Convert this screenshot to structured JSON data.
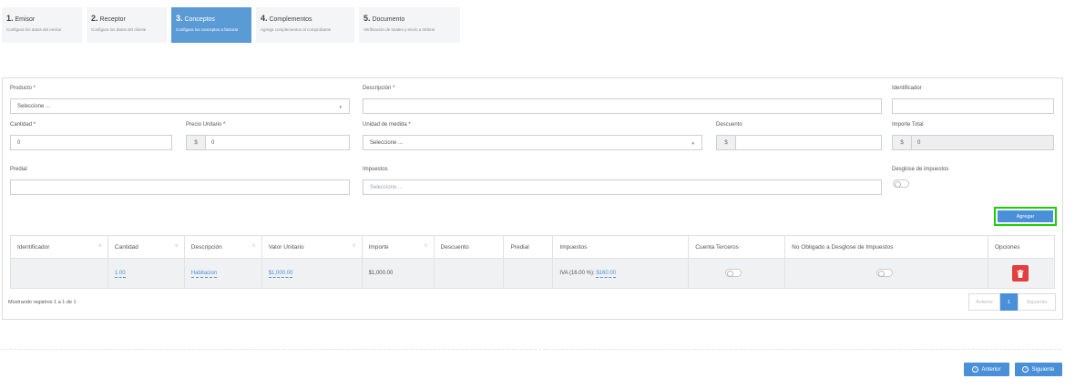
{
  "steps": [
    {
      "num": "1.",
      "title": "Emisor",
      "sub": "Configura los datos del emisor"
    },
    {
      "num": "2.",
      "title": "Receptor",
      "sub": "Configura los datos del cliente"
    },
    {
      "num": "3.",
      "title": "Conceptos",
      "sub": "Configura los conceptos a facturar"
    },
    {
      "num": "4.",
      "title": "Complementos",
      "sub": "Agrega complementos al comprobante"
    },
    {
      "num": "5.",
      "title": "Documento",
      "sub": "Verificación de totales y envío a timbrar"
    }
  ],
  "form": {
    "producto_label": "Producto *",
    "producto_value": "Seleccione ...",
    "descripcion_label": "Descripción *",
    "descripcion_value": "",
    "identificador_label": "Identificador",
    "identificador_value": "",
    "cantidad_label": "Cantidad *",
    "cantidad_value": "0",
    "precio_label": "Precio Unitario *",
    "precio_value": "0",
    "unidad_label": "Unidad de medida *",
    "unidad_value": "Seleccione ...",
    "descuento_label": "Descuento",
    "descuento_value": "",
    "importe_label": "Importe Total",
    "importe_value": "0",
    "predial_label": "Predial",
    "predial_value": "",
    "impuestos_label": "Impuestos",
    "impuestos_placeholder": "Seleccione ...",
    "desglose_label": "Desglose de impuestos",
    "currency_symbol": "$"
  },
  "add_button": "Agregar",
  "table": {
    "headers": [
      "Identificador",
      "Cantidad",
      "Descripción",
      "Valor Unitario",
      "Importe",
      "Descuento",
      "Predial",
      "Impuestos",
      "Cuenta Terceros",
      "No Obligado a Desglose de Impuestos",
      "Opciones"
    ],
    "rows": [
      {
        "identificador": "",
        "cantidad": "1.00",
        "descripcion": "Habitacion",
        "valor_unitario": "$1,000.00",
        "importe": "$1,000.00",
        "descuento": "",
        "predial": "",
        "impuestos_label": "IVA (16.00 %):",
        "impuestos_value": "$160.00"
      }
    ]
  },
  "showing_text": "Mostrando registros 1 a 1 de 1",
  "pagination": {
    "prev": "Anterior",
    "current": "1",
    "next": "Siguiente"
  },
  "nav": {
    "back": "Anterior",
    "next": "Siguiente"
  },
  "colors": {
    "accent": "#4a90d9",
    "active_step": "#5b9bd5",
    "delete": "#e53e3e",
    "highlight": "#1bd000"
  }
}
